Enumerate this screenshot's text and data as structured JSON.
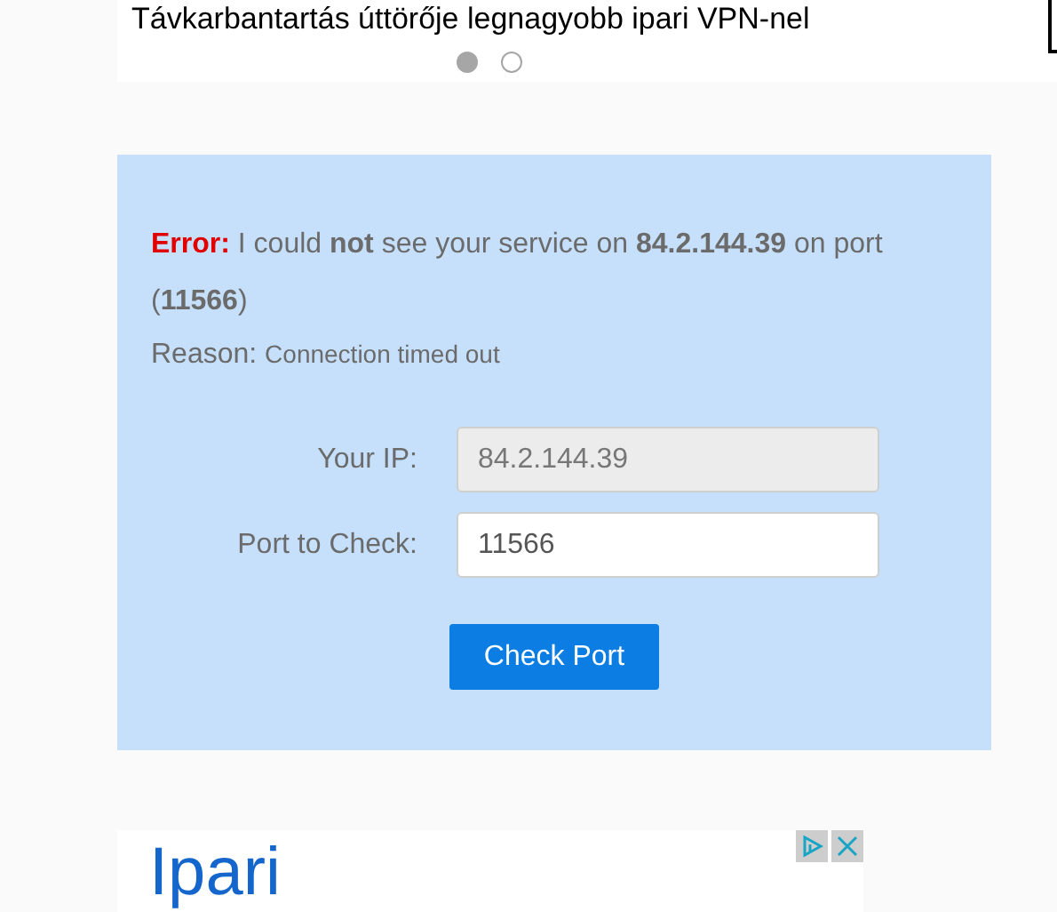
{
  "carousel": {
    "caption": "Távkarbantartás úttörője legnagyobb ipari VPN-nel",
    "dots": [
      {
        "selected": true
      },
      {
        "selected": false
      }
    ]
  },
  "result": {
    "label": "Error:",
    "message": "I could **not** see your service on **84.2.144.39** on port (**11566**)",
    "reason_label": "Reason:",
    "reason": "Connection timed out"
  },
  "form": {
    "fields": [
      {
        "label": "Your IP:",
        "value": "84.2.144.39",
        "disabled": true
      },
      {
        "label": "Port to Check:",
        "value": "11566",
        "disabled": false
      }
    ],
    "button": "Check Port"
  },
  "ad": {
    "headline": "Ipari"
  }
}
